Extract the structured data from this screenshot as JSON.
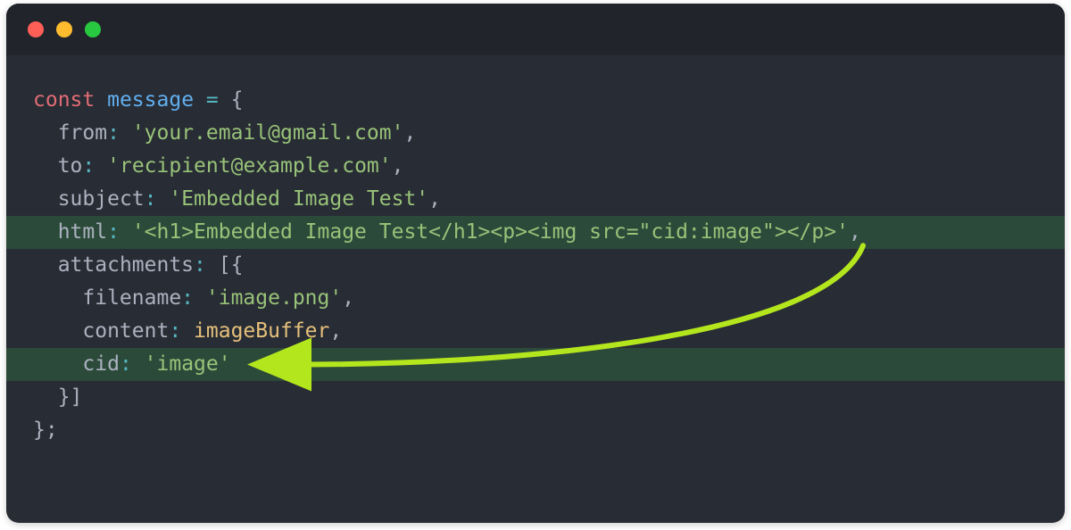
{
  "window": {
    "traffic_lights": [
      "close",
      "minimize",
      "maximize"
    ]
  },
  "code": {
    "lines": [
      {
        "indent": 0,
        "hl": false,
        "tokens": [
          [
            "kw",
            "const"
          ],
          [
            "punc",
            " "
          ],
          [
            "var",
            "message"
          ],
          [
            "punc",
            " "
          ],
          [
            "oper",
            "="
          ],
          [
            "punc",
            " {"
          ]
        ]
      },
      {
        "indent": 1,
        "hl": false,
        "tokens": [
          [
            "prop",
            "from"
          ],
          [
            "oper",
            ":"
          ],
          [
            "punc",
            " "
          ],
          [
            "str",
            "'your.email@gmail.com'"
          ],
          [
            "punc",
            ","
          ]
        ]
      },
      {
        "indent": 1,
        "hl": false,
        "tokens": [
          [
            "prop",
            "to"
          ],
          [
            "oper",
            ":"
          ],
          [
            "punc",
            " "
          ],
          [
            "str",
            "'recipient@example.com'"
          ],
          [
            "punc",
            ","
          ]
        ]
      },
      {
        "indent": 1,
        "hl": false,
        "tokens": [
          [
            "prop",
            "subject"
          ],
          [
            "oper",
            ":"
          ],
          [
            "punc",
            " "
          ],
          [
            "str",
            "'Embedded Image Test'"
          ],
          [
            "punc",
            ","
          ]
        ]
      },
      {
        "indent": 1,
        "hl": true,
        "tokens": [
          [
            "prop",
            "html"
          ],
          [
            "oper",
            ":"
          ],
          [
            "punc",
            " "
          ],
          [
            "str",
            "'<h1>Embedded Image Test</h1><p><img src=\"cid:image\"></p>'"
          ],
          [
            "punc",
            ","
          ]
        ]
      },
      {
        "indent": 1,
        "hl": false,
        "tokens": [
          [
            "prop",
            "attachments"
          ],
          [
            "oper",
            ":"
          ],
          [
            "punc",
            " [{"
          ]
        ]
      },
      {
        "indent": 2,
        "hl": false,
        "tokens": [
          [
            "prop",
            "filename"
          ],
          [
            "oper",
            ":"
          ],
          [
            "punc",
            " "
          ],
          [
            "str",
            "'image.png'"
          ],
          [
            "punc",
            ","
          ]
        ]
      },
      {
        "indent": 2,
        "hl": false,
        "tokens": [
          [
            "prop",
            "content"
          ],
          [
            "oper",
            ":"
          ],
          [
            "punc",
            " "
          ],
          [
            "ident",
            "imageBuffer"
          ],
          [
            "punc",
            ","
          ]
        ]
      },
      {
        "indent": 2,
        "hl": true,
        "tokens": [
          [
            "prop",
            "cid"
          ],
          [
            "oper",
            ":"
          ],
          [
            "punc",
            " "
          ],
          [
            "str",
            "'image'"
          ]
        ]
      },
      {
        "indent": 1,
        "hl": false,
        "tokens": [
          [
            "punc",
            "}]"
          ]
        ]
      },
      {
        "indent": 0,
        "hl": false,
        "tokens": [
          [
            "punc",
            "};"
          ]
        ]
      }
    ]
  },
  "arrow": {
    "color": "#b4e61e",
    "from_line_index": 4,
    "to_line_index": 8,
    "label": "cid-reference-arrow"
  }
}
